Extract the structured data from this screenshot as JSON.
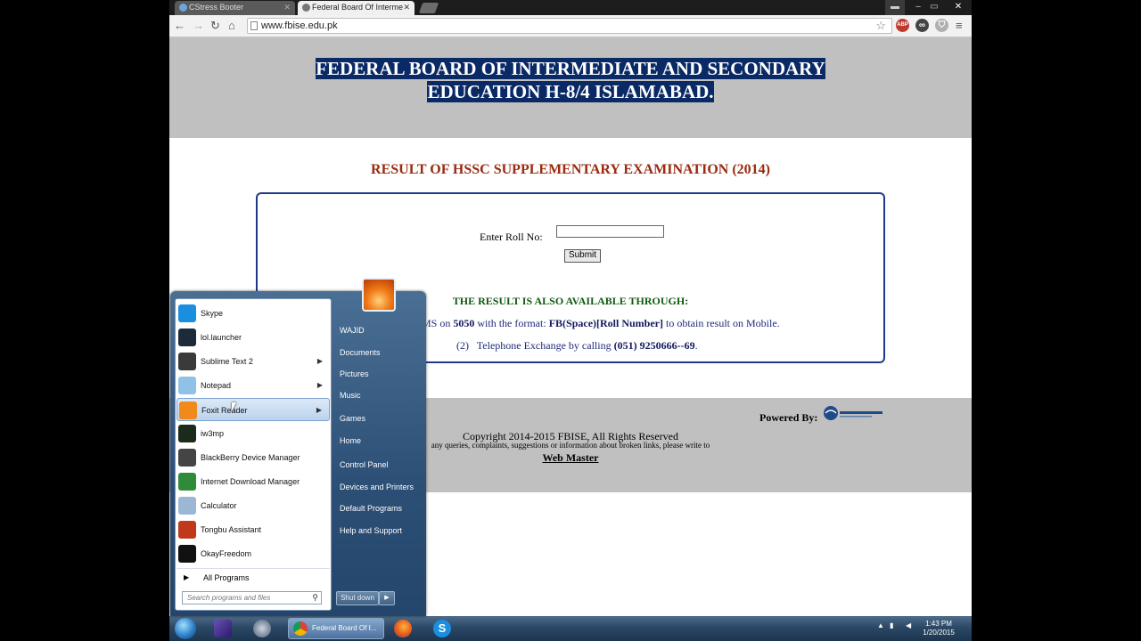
{
  "tabs": [
    {
      "title": "CStress Booter"
    },
    {
      "title": "Federal Board Of Interme"
    }
  ],
  "address": "www.fbise.edu.pk",
  "extensions": [
    "ABP",
    "glasses-icon",
    "shield-icon"
  ],
  "page": {
    "heading_line1": "FEDERAL BOARD OF INTERMEDIATE AND SECONDARY",
    "heading_line2": "EDUCATION H-8/4 ISLAMABAD.",
    "result_title": "RESULT OF HSSC SUPPLEMENTARY EXAMINATION (2014)",
    "roll_label": "Enter Roll No:",
    "roll_value": "",
    "submit_label": "Submit",
    "available_heading": "THE RESULT IS ALSO AVAILABLE THROUGH:",
    "sms_prefix": "By sending SMS on",
    "sms_number": "5050",
    "sms_mid": "with the format:",
    "sms_format": "FB(Space)[Roll Number]",
    "sms_suffix": "to obtain result on Mobile.",
    "tel_index": "(2)",
    "tel_text": "Telephone Exchange by calling",
    "tel_number": "(051) 9250666--69",
    "tel_end": ".",
    "powered_by": "Powered By:",
    "copyright": "Copyright 2014-2015 FBISE, All Rights Reserved",
    "queries": "any queries, complaints, suggestions or information about broken links, please write to",
    "webmaster": "Web Master"
  },
  "start_menu": {
    "programs": [
      {
        "label": "Skype",
        "icon": "skype-icon",
        "color": "#1a8fe0",
        "submenu": false
      },
      {
        "label": "lol.launcher",
        "icon": "lol-icon",
        "color": "#1d2a3a",
        "submenu": false
      },
      {
        "label": "Sublime Text 2",
        "icon": "sublime-icon",
        "color": "#3a3a3a",
        "submenu": true
      },
      {
        "label": "Notepad",
        "icon": "notepad-icon",
        "color": "#8fc2e6",
        "submenu": true
      },
      {
        "label": "Foxit Reader",
        "icon": "foxit-icon",
        "color": "#f08a1c",
        "submenu": true
      },
      {
        "label": "iw3mp",
        "icon": "cod-icon",
        "color": "#1b2a1b",
        "submenu": false
      },
      {
        "label": "BlackBerry Device Manager",
        "icon": "blackberry-icon",
        "color": "#444444",
        "submenu": false
      },
      {
        "label": "Internet Download Manager",
        "icon": "idm-icon",
        "color": "#2f8a3a",
        "submenu": false
      },
      {
        "label": "Calculator",
        "icon": "calculator-icon",
        "color": "#9bb7d6",
        "submenu": false
      },
      {
        "label": "Tongbu Assistant",
        "icon": "tongbu-icon",
        "color": "#c0391b",
        "submenu": false
      },
      {
        "label": "OkayFreedom",
        "icon": "okayfreedom-icon",
        "color": "#111111",
        "submenu": false
      }
    ],
    "all_programs": "All Programs",
    "search_placeholder": "Search programs and files",
    "user": "WAJID",
    "right_items": [
      "Documents",
      "Pictures",
      "Music",
      "Games",
      "Home",
      "Control Panel",
      "Devices and Printers",
      "Default Programs",
      "Help and Support"
    ],
    "shutdown": "Shut down"
  },
  "taskbar": {
    "active_task": "Federal Board Of I...",
    "time": "1:43 PM",
    "date": "1/20/2015"
  }
}
